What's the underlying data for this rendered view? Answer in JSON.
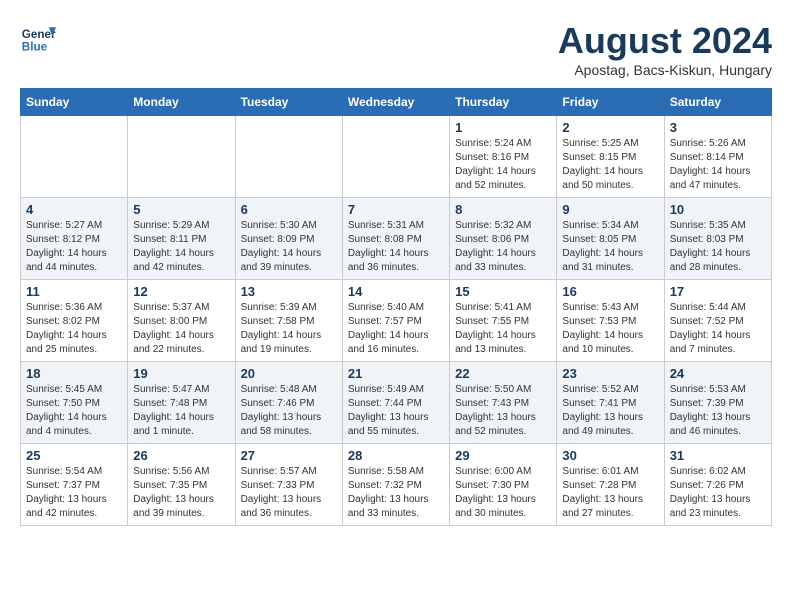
{
  "header": {
    "logo_line1": "General",
    "logo_line2": "Blue",
    "month_year": "August 2024",
    "location": "Apostag, Bacs-Kiskun, Hungary"
  },
  "days_of_week": [
    "Sunday",
    "Monday",
    "Tuesday",
    "Wednesday",
    "Thursday",
    "Friday",
    "Saturday"
  ],
  "weeks": [
    [
      {
        "day": "",
        "info": ""
      },
      {
        "day": "",
        "info": ""
      },
      {
        "day": "",
        "info": ""
      },
      {
        "day": "",
        "info": ""
      },
      {
        "day": "1",
        "info": "Sunrise: 5:24 AM\nSunset: 8:16 PM\nDaylight: 14 hours\nand 52 minutes."
      },
      {
        "day": "2",
        "info": "Sunrise: 5:25 AM\nSunset: 8:15 PM\nDaylight: 14 hours\nand 50 minutes."
      },
      {
        "day": "3",
        "info": "Sunrise: 5:26 AM\nSunset: 8:14 PM\nDaylight: 14 hours\nand 47 minutes."
      }
    ],
    [
      {
        "day": "4",
        "info": "Sunrise: 5:27 AM\nSunset: 8:12 PM\nDaylight: 14 hours\nand 44 minutes."
      },
      {
        "day": "5",
        "info": "Sunrise: 5:29 AM\nSunset: 8:11 PM\nDaylight: 14 hours\nand 42 minutes."
      },
      {
        "day": "6",
        "info": "Sunrise: 5:30 AM\nSunset: 8:09 PM\nDaylight: 14 hours\nand 39 minutes."
      },
      {
        "day": "7",
        "info": "Sunrise: 5:31 AM\nSunset: 8:08 PM\nDaylight: 14 hours\nand 36 minutes."
      },
      {
        "day": "8",
        "info": "Sunrise: 5:32 AM\nSunset: 8:06 PM\nDaylight: 14 hours\nand 33 minutes."
      },
      {
        "day": "9",
        "info": "Sunrise: 5:34 AM\nSunset: 8:05 PM\nDaylight: 14 hours\nand 31 minutes."
      },
      {
        "day": "10",
        "info": "Sunrise: 5:35 AM\nSunset: 8:03 PM\nDaylight: 14 hours\nand 28 minutes."
      }
    ],
    [
      {
        "day": "11",
        "info": "Sunrise: 5:36 AM\nSunset: 8:02 PM\nDaylight: 14 hours\nand 25 minutes."
      },
      {
        "day": "12",
        "info": "Sunrise: 5:37 AM\nSunset: 8:00 PM\nDaylight: 14 hours\nand 22 minutes."
      },
      {
        "day": "13",
        "info": "Sunrise: 5:39 AM\nSunset: 7:58 PM\nDaylight: 14 hours\nand 19 minutes."
      },
      {
        "day": "14",
        "info": "Sunrise: 5:40 AM\nSunset: 7:57 PM\nDaylight: 14 hours\nand 16 minutes."
      },
      {
        "day": "15",
        "info": "Sunrise: 5:41 AM\nSunset: 7:55 PM\nDaylight: 14 hours\nand 13 minutes."
      },
      {
        "day": "16",
        "info": "Sunrise: 5:43 AM\nSunset: 7:53 PM\nDaylight: 14 hours\nand 10 minutes."
      },
      {
        "day": "17",
        "info": "Sunrise: 5:44 AM\nSunset: 7:52 PM\nDaylight: 14 hours\nand 7 minutes."
      }
    ],
    [
      {
        "day": "18",
        "info": "Sunrise: 5:45 AM\nSunset: 7:50 PM\nDaylight: 14 hours\nand 4 minutes."
      },
      {
        "day": "19",
        "info": "Sunrise: 5:47 AM\nSunset: 7:48 PM\nDaylight: 14 hours\nand 1 minute."
      },
      {
        "day": "20",
        "info": "Sunrise: 5:48 AM\nSunset: 7:46 PM\nDaylight: 13 hours\nand 58 minutes."
      },
      {
        "day": "21",
        "info": "Sunrise: 5:49 AM\nSunset: 7:44 PM\nDaylight: 13 hours\nand 55 minutes."
      },
      {
        "day": "22",
        "info": "Sunrise: 5:50 AM\nSunset: 7:43 PM\nDaylight: 13 hours\nand 52 minutes."
      },
      {
        "day": "23",
        "info": "Sunrise: 5:52 AM\nSunset: 7:41 PM\nDaylight: 13 hours\nand 49 minutes."
      },
      {
        "day": "24",
        "info": "Sunrise: 5:53 AM\nSunset: 7:39 PM\nDaylight: 13 hours\nand 46 minutes."
      }
    ],
    [
      {
        "day": "25",
        "info": "Sunrise: 5:54 AM\nSunset: 7:37 PM\nDaylight: 13 hours\nand 42 minutes."
      },
      {
        "day": "26",
        "info": "Sunrise: 5:56 AM\nSunset: 7:35 PM\nDaylight: 13 hours\nand 39 minutes."
      },
      {
        "day": "27",
        "info": "Sunrise: 5:57 AM\nSunset: 7:33 PM\nDaylight: 13 hours\nand 36 minutes."
      },
      {
        "day": "28",
        "info": "Sunrise: 5:58 AM\nSunset: 7:32 PM\nDaylight: 13 hours\nand 33 minutes."
      },
      {
        "day": "29",
        "info": "Sunrise: 6:00 AM\nSunset: 7:30 PM\nDaylight: 13 hours\nand 30 minutes."
      },
      {
        "day": "30",
        "info": "Sunrise: 6:01 AM\nSunset: 7:28 PM\nDaylight: 13 hours\nand 27 minutes."
      },
      {
        "day": "31",
        "info": "Sunrise: 6:02 AM\nSunset: 7:26 PM\nDaylight: 13 hours\nand 23 minutes."
      }
    ]
  ]
}
